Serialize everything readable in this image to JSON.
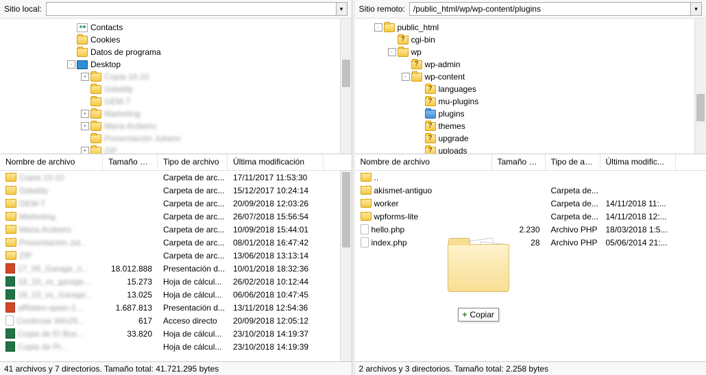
{
  "local": {
    "label": "Sitio local:",
    "path": "",
    "tree": [
      {
        "indent": 90,
        "exp": "",
        "icon": "contacts",
        "label": "Contacts",
        "blur": false
      },
      {
        "indent": 90,
        "exp": "",
        "icon": "folder",
        "label": "Cookies",
        "blur": false
      },
      {
        "indent": 90,
        "exp": "",
        "icon": "folder",
        "label": "Datos de programa",
        "blur": false
      },
      {
        "indent": 90,
        "exp": "-",
        "icon": "desk",
        "label": "Desktop",
        "blur": false
      },
      {
        "indent": 110,
        "exp": "+",
        "icon": "folder",
        "label": "Copia 10-10",
        "blur": true
      },
      {
        "indent": 110,
        "exp": "",
        "icon": "folder",
        "label": "Gdaddy",
        "blur": true
      },
      {
        "indent": 110,
        "exp": "",
        "icon": "folder",
        "label": "GEM-T",
        "blur": true
      },
      {
        "indent": 110,
        "exp": "+",
        "icon": "folder",
        "label": "Marketing",
        "blur": true
      },
      {
        "indent": 110,
        "exp": "+",
        "icon": "folder",
        "label": "Maria Acibeiro",
        "blur": true
      },
      {
        "indent": 110,
        "exp": "",
        "icon": "folder",
        "label": "Presentación Juliano",
        "blur": true
      },
      {
        "indent": 110,
        "exp": "+",
        "icon": "folder",
        "label": "ZIP",
        "blur": true
      }
    ],
    "cols": {
      "name": "Nombre de archivo",
      "size": "Tamaño de...",
      "type": "Tipo de archivo",
      "date": "Última modificación"
    },
    "files": [
      {
        "icon": "folder",
        "name": "Copia 10-10",
        "blur": true,
        "size": "",
        "type": "Carpeta de arc...",
        "date": "17/11/2017 11:53:30"
      },
      {
        "icon": "folder",
        "name": "Gdaddy",
        "blur": true,
        "size": "",
        "type": "Carpeta de arc...",
        "date": "15/12/2017 10:24:14"
      },
      {
        "icon": "folder",
        "name": "GEM-T",
        "blur": true,
        "size": "",
        "type": "Carpeta de arc...",
        "date": "20/09/2018 12:03:26"
      },
      {
        "icon": "folder",
        "name": "Marketing",
        "blur": true,
        "size": "",
        "type": "Carpeta de arc...",
        "date": "26/07/2018 15:56:54"
      },
      {
        "icon": "folder",
        "name": "Maria Acibeiro",
        "blur": true,
        "size": "",
        "type": "Carpeta de arc...",
        "date": "10/09/2018 15:44:01"
      },
      {
        "icon": "folder",
        "name": "Presentación Jul...",
        "blur": true,
        "size": "",
        "type": "Carpeta de arc...",
        "date": "08/01/2018 16:47:42"
      },
      {
        "icon": "folder",
        "name": "ZIP",
        "blur": true,
        "size": "",
        "type": "Carpeta de arc...",
        "date": "13/06/2018 13:13:14"
      },
      {
        "icon": "ppt",
        "name": "17_06_Garage_n...",
        "blur": true,
        "size": "18.012.888",
        "type": "Presentación d...",
        "date": "10/01/2018 18:32:36"
      },
      {
        "icon": "xls",
        "name": "18_10_vs_garage...",
        "blur": true,
        "size": "15.273",
        "type": "Hoja de cálcul...",
        "date": "26/02/2018 10:12:44"
      },
      {
        "icon": "xls",
        "name": "18_10_vs_Garage...",
        "blur": true,
        "size": "13.025",
        "type": "Hoja de cálcul...",
        "date": "06/06/2018 10:47:45"
      },
      {
        "icon": "ppt",
        "name": "affilates-spain-2...",
        "blur": true,
        "size": "1.687.813",
        "type": "Presentación d...",
        "date": "13/11/2018 12:54:36"
      },
      {
        "icon": "file",
        "name": "Continuar Win25...",
        "blur": true,
        "size": "617",
        "type": "Acceso directo",
        "date": "20/09/2018 12:05:12"
      },
      {
        "icon": "xls",
        "name": "Copia de El Bos...",
        "blur": true,
        "size": "33.820",
        "type": "Hoja de cálcul...",
        "date": "23/10/2018 14:19:37"
      },
      {
        "icon": "xls",
        "name": "Copia de Pr...",
        "blur": true,
        "size": "",
        "type": "Hoja de cálcul...",
        "date": "23/10/2018 14:19:39"
      }
    ],
    "status": "41 archivos y 7 directorios. Tamaño total: 41.721.295 bytes"
  },
  "remote": {
    "label": "Sitio remoto:",
    "path": "/public_html/wp/wp-content/plugins",
    "tree": [
      {
        "indent": 20,
        "exp": "-",
        "icon": "folder",
        "label": "public_html"
      },
      {
        "indent": 40,
        "exp": "",
        "icon": "folder q",
        "label": "cgi-bin"
      },
      {
        "indent": 40,
        "exp": "-",
        "icon": "folder",
        "label": "wp"
      },
      {
        "indent": 60,
        "exp": "",
        "icon": "folder q",
        "label": "wp-admin"
      },
      {
        "indent": 60,
        "exp": "-",
        "icon": "folder",
        "label": "wp-content"
      },
      {
        "indent": 80,
        "exp": "",
        "icon": "folder q",
        "label": "languages"
      },
      {
        "indent": 80,
        "exp": "",
        "icon": "folder q",
        "label": "mu-plugins"
      },
      {
        "indent": 80,
        "exp": "",
        "icon": "folder sel",
        "label": "plugins"
      },
      {
        "indent": 80,
        "exp": "",
        "icon": "folder q",
        "label": "themes"
      },
      {
        "indent": 80,
        "exp": "",
        "icon": "folder q",
        "label": "upgrade"
      },
      {
        "indent": 80,
        "exp": "",
        "icon": "folder q",
        "label": "uploads"
      }
    ],
    "cols": {
      "name": "Nombre de archivo",
      "size": "Tamaño d...",
      "type": "Tipo de arc...",
      "date": "Última modific..."
    },
    "files": [
      {
        "icon": "folder",
        "name": "..",
        "size": "",
        "type": "",
        "date": ""
      },
      {
        "icon": "folder",
        "name": "akismet-antiguo",
        "size": "",
        "type": "Carpeta de...",
        "date": ""
      },
      {
        "icon": "folder",
        "name": "worker",
        "size": "",
        "type": "Carpeta de...",
        "date": "14/11/2018 11:..."
      },
      {
        "icon": "folder",
        "name": "wpforms-lite",
        "size": "",
        "type": "Carpeta de...",
        "date": "14/11/2018 12:..."
      },
      {
        "icon": "file",
        "name": "hello.php",
        "size": "2.230",
        "type": "Archivo PHP",
        "date": "18/03/2018 1:5..."
      },
      {
        "icon": "file",
        "name": "index.php",
        "size": "28",
        "type": "Archivo PHP",
        "date": "05/06/2014 21:..."
      }
    ],
    "status": "2 archivos y 3 directorios. Tamaño total: 2.258 bytes",
    "copy_label": "Copiar"
  }
}
